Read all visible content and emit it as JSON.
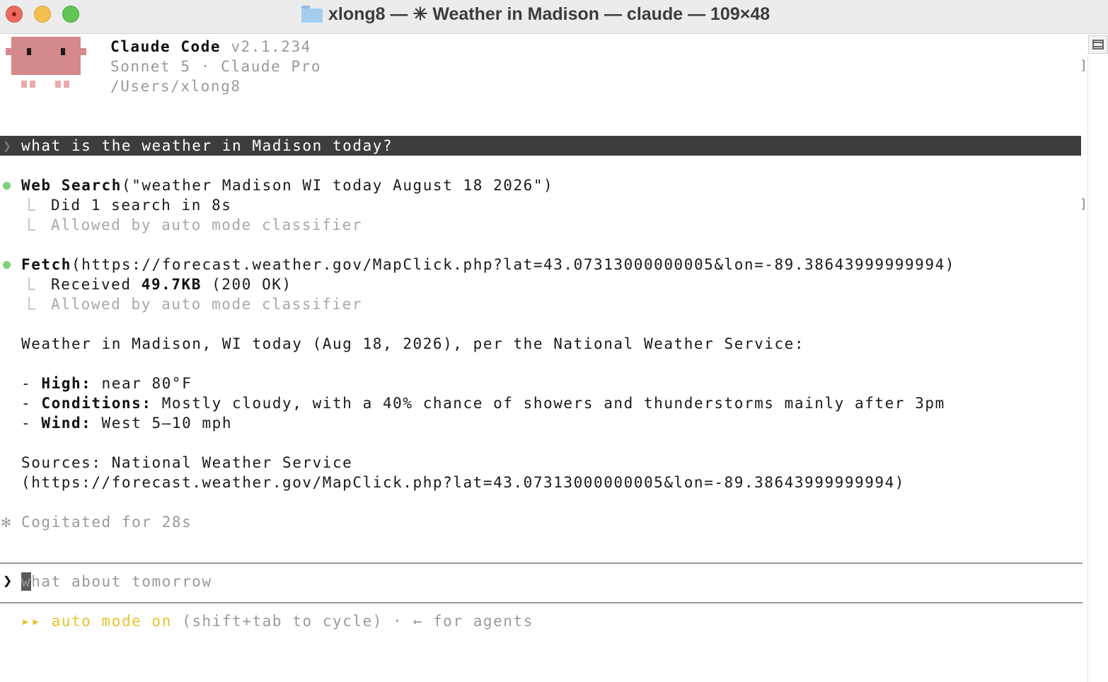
{
  "window": {
    "title": "xlong8 — ✳ Weather in Madison — claude — 109×48"
  },
  "header": {
    "app_name": "Claude Code",
    "version": "v2.1.234",
    "model": "Sonnet 5 · Claude Pro",
    "cwd": "/Users/xlong8"
  },
  "conversation": {
    "user_prompt": "what is the weather in Madison today?",
    "tools": [
      {
        "name": "Web Search",
        "args": "(\"weather Madison WI today August 18 2026\")",
        "result": "Did 1 search in 8s",
        "permission": "Allowed by auto mode classifier"
      },
      {
        "name": "Fetch",
        "args": "(https://forecast.weather.gov/MapClick.php?lat=43.07313000000005&lon=-89.38643999999994)",
        "result_prefix": "Received ",
        "result_bold": "49.7KB",
        "result_suffix": " (200 OK)",
        "permission": "Allowed by auto mode classifier"
      }
    ],
    "answer_intro": "Weather in Madison, WI today (Aug 18, 2026), per the National Weather Service:",
    "bullets": [
      {
        "dash": "- ",
        "label": "High:",
        "text": " near 80°F"
      },
      {
        "dash": "- ",
        "label": "Conditions:",
        "text": " Mostly cloudy, with a 40% chance of showers and thunderstorms mainly after 3pm"
      },
      {
        "dash": "- ",
        "label": "Wind:",
        "text": " West 5–10 mph"
      }
    ],
    "sources_line1": "Sources: National Weather Service",
    "sources_line2": "(https://forecast.weather.gov/MapClick.php?lat=43.07313000000005&lon=-89.38643999999994)",
    "status": "Cogitated for 28s"
  },
  "input": {
    "prompt_symbol": "❯",
    "placeholder": "what about tomorrow"
  },
  "footer": {
    "arrows": "▸▸",
    "mode": "auto mode on",
    "hint": "(shift+tab to cycle) · ← for agents"
  },
  "colors": {
    "mode_accent": "#e8c32b",
    "tool_dot": "#7ed07a",
    "mascot": "#d4898a"
  }
}
